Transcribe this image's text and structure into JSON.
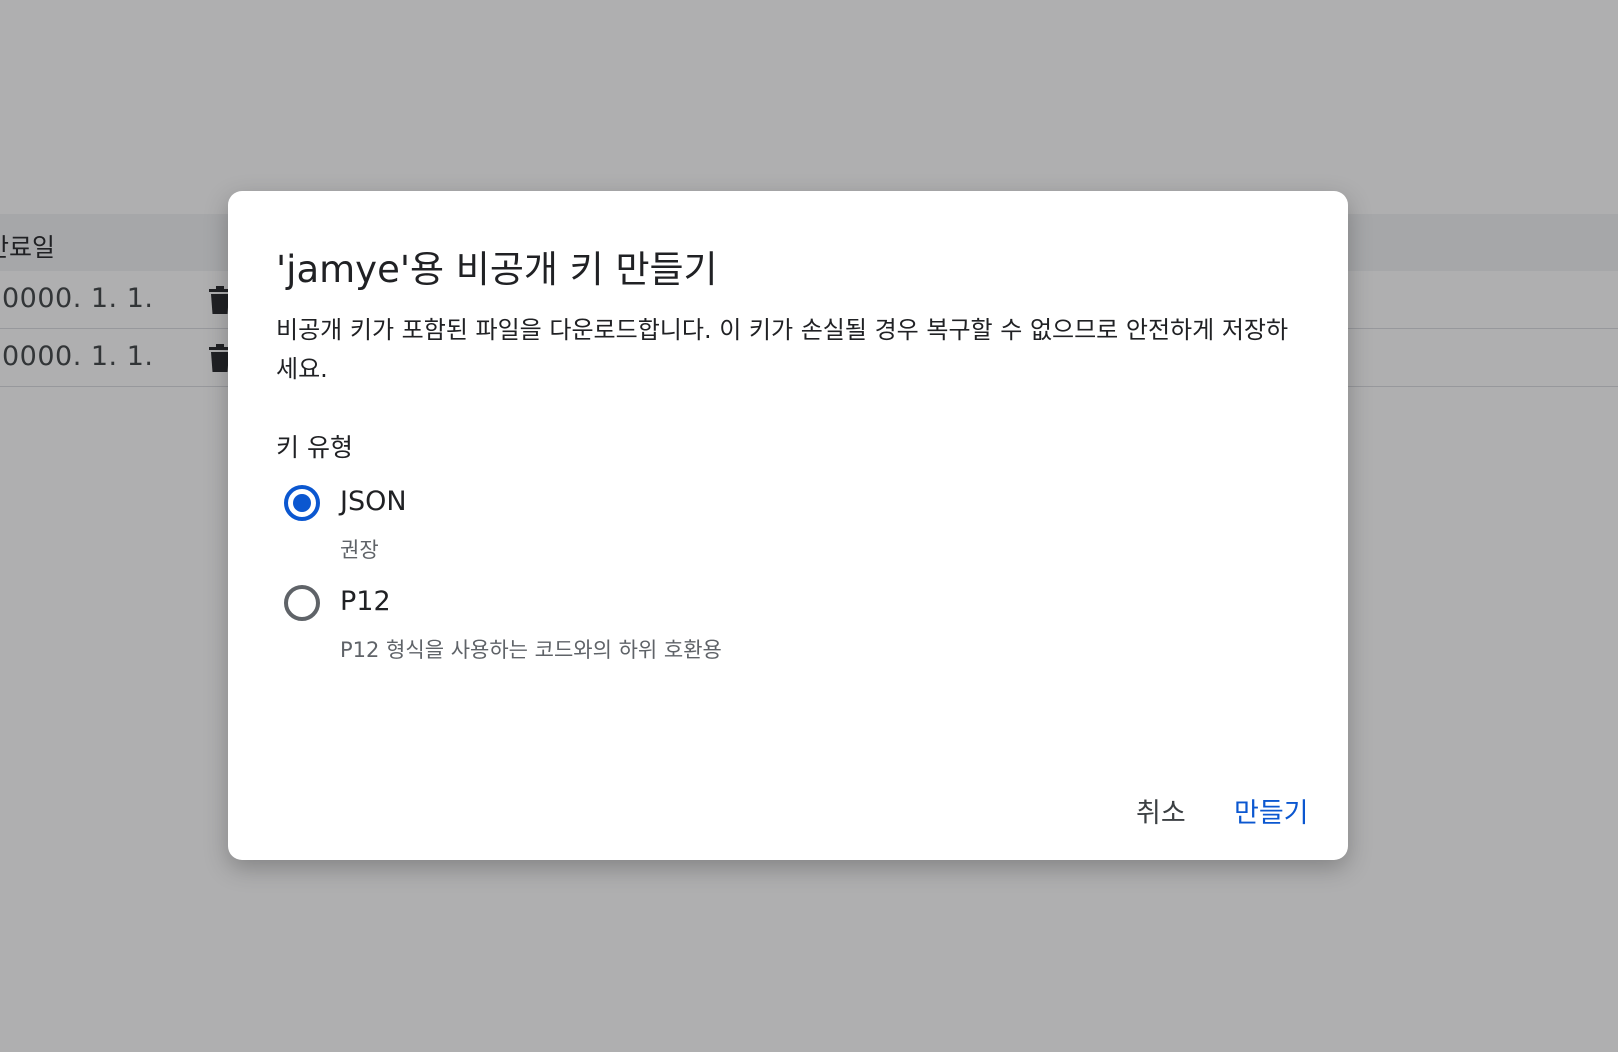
{
  "background": {
    "table": {
      "column_header": "만료일",
      "rows": [
        {
          "expiry": "0000. 1. 1."
        },
        {
          "expiry": "0000. 1. 1."
        }
      ],
      "row_action_icon": "trash-icon"
    }
  },
  "dialog": {
    "title": "'jamye'용 비공개 키 만들기",
    "description": "비공개 키가 포함된 파일을 다운로드합니다. 이 키가 손실될 경우 복구할 수 없으므로 안전하게 저장하세요.",
    "key_type_label": "키 유형",
    "options": [
      {
        "label": "JSON",
        "sublabel": "권장",
        "selected": true
      },
      {
        "label": "P12",
        "sublabel": "P12 형식을 사용하는 코드와의 하위 호환용",
        "selected": false
      }
    ],
    "cancel_label": "취소",
    "create_label": "만들기"
  },
  "colors": {
    "accent": "#0b57d0",
    "scrim": "#202124"
  }
}
